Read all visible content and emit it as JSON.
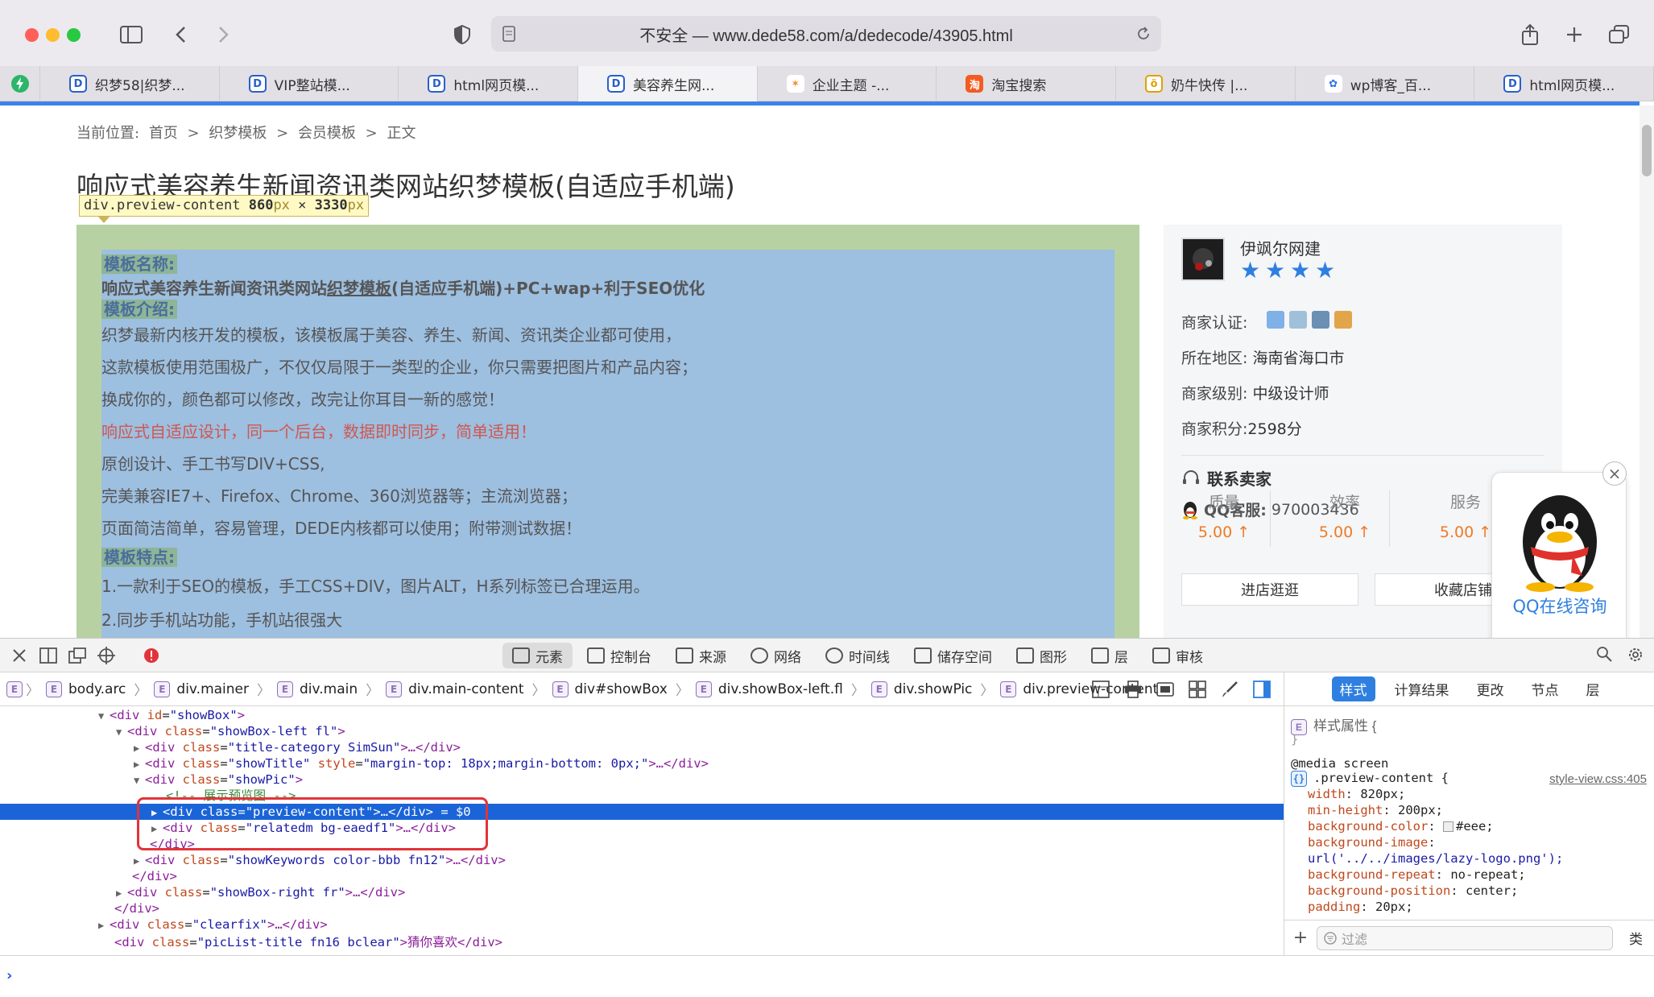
{
  "browser": {
    "url": "不安全 — www.dede58.com/a/dedecode/43905.html",
    "tabs": [
      {
        "label": "织梦58|织梦...",
        "icon": "dede-icon"
      },
      {
        "label": "VIP整站模...",
        "icon": "dede-icon"
      },
      {
        "label": "html网页模...",
        "icon": "dede-icon"
      },
      {
        "label": "美容养生网...",
        "icon": "dede-icon",
        "active": true
      },
      {
        "label": "企业主题 -...",
        "icon": "star-logo-icon"
      },
      {
        "label": "淘宝搜索",
        "icon": "taobao-icon"
      },
      {
        "label": "奶牛快传 |...",
        "icon": "cow-icon"
      },
      {
        "label": "wp博客_百...",
        "icon": "baidu-paw-icon"
      },
      {
        "label": "html网页模...",
        "icon": "dede-icon"
      }
    ],
    "tab_fav_letters": {
      "dede": "D",
      "taobao": "淘",
      "cow": "ö",
      "paw": "✿",
      "star": "✶"
    }
  },
  "page": {
    "breadcrumb": {
      "prefix": "当前位置:",
      "items": [
        "首页",
        ">",
        "织梦模板",
        ">",
        "会员模板",
        ">",
        "正文"
      ]
    },
    "title": "响应式美容养生新闻资讯类网站织梦模板(自适应手机端)",
    "tooltip": {
      "selector": "div.preview-content",
      "w": "860",
      "h": "3330",
      "px": "px",
      "x": " × "
    },
    "content": {
      "name_label": "模板名称:",
      "name_value_pre": "响应式美容养生新闻资讯类网站",
      "name_value_link": "织梦模板",
      "name_value_post": "(自适应手机端)+PC+wap+利于SEO优化",
      "intro_label": "模板介绍:",
      "intro_lines": [
        "织梦最新内核开发的模板，该模板属于美容、养生、新闻、资讯类企业都可使用，",
        "这款模板使用范围极广，不仅仅局限于一类型的企业，你只需要把图片和产品内容；",
        "换成你的，颜色都可以修改，改完让你耳目一新的感觉！"
      ],
      "red_line": "响应式自适应设计，同一个后台，数据即时同步，简单适用！",
      "lines2": [
        "原创设计、手工书写DIV+CSS,",
        "完美兼容IE7+、Firefox、Chrome、360浏览器等；主流浏览器；",
        "页面简洁简单，容易管理，DEDE内核都可以使用；附带测试数据！"
      ],
      "feature_label": "模板特点:",
      "feature_lines": [
        "1.一款利于SEO的模板，手工CSS+DIV，图片ALT，H系列标签已合理运用。",
        "2.同步手机站功能，手机站很强大"
      ]
    },
    "shop": {
      "name": "伊飒尔网建",
      "star_glyph": "★",
      "cert_label": "商家认证:",
      "region_label": "所在地区:",
      "region": "海南省海口市",
      "level_label": "商家级别:",
      "level": "中级设计师",
      "points_label": "商家积分:",
      "points": "2598分",
      "contact_title": "联系卖家",
      "qq_label": "QQ客服:",
      "qq": "970003436",
      "scores": [
        {
          "label": "质量",
          "value": "5.00 ↑"
        },
        {
          "label": "效率",
          "value": "5.00 ↑"
        },
        {
          "label": "服务",
          "value": "5.00 ↑"
        }
      ],
      "btn_visit": "进店逛逛",
      "btn_fav": "收藏店铺"
    },
    "qq_float": {
      "label": "QQ在线咨询",
      "close": "×"
    }
  },
  "devtools": {
    "tabs": [
      "元素",
      "控制台",
      "来源",
      "网络",
      "时间线",
      "储存空间",
      "图形",
      "层",
      "审核"
    ],
    "crumbs": [
      "body.arc",
      "div.mainer",
      "div.main",
      "div.main-content",
      "div#showBox",
      "div.showBox-left.fl",
      "div.showPic",
      "div.preview-content"
    ],
    "crumb_badge": "E",
    "dom": {
      "l1": {
        "tag": "div",
        "attr": "id",
        "val": "\"showBox\"",
        "close": ">"
      },
      "l2": {
        "tag": "div",
        "attr": "class",
        "val": "\"showBox-left fl\"",
        "close": ">"
      },
      "l3": {
        "attr": "class",
        "val": "\"title-category SimSun\"",
        "rest": ">…</div>"
      },
      "l4": {
        "attr1": "class",
        "val1": "\"showTitle\"",
        "attr2": "style",
        "val2": "\"margin-top: 18px;margin-bottom: 0px;\"",
        "rest": ">…</div>"
      },
      "l5": {
        "attr": "class",
        "val": "\"showPic\"",
        "close": ">"
      },
      "l6": {
        "comment": "<!-- 展示预览图 -->"
      },
      "l7": {
        "attr": "class",
        "val": "\"preview-content\"",
        "rest": ">…</div>",
        "eq": " = $0"
      },
      "l8": {
        "attr": "class",
        "val": "\"relatedm bg-eaedf1\"",
        "rest": ">…</div>"
      },
      "l9": {
        "text": "</div>"
      },
      "l10": {
        "attr": "class",
        "val": "\"showKeywords color-bbb fn12\"",
        "rest": ">…</div>"
      },
      "l11": {
        "text": "</div>"
      },
      "l12": {
        "attr": "class",
        "val": "\"showBox-right fr\"",
        "rest": ">…</div>"
      },
      "l13": {
        "text": "</div>"
      },
      "l14": {
        "attr": "class",
        "val": "\"clearfix\"",
        "rest": ">…</div>"
      },
      "l15": {
        "attr": "class",
        "val": "\"picList-title fn16 bclear\"",
        "rest": ">猜你喜欢</div>"
      },
      "open_tag": "<div ",
      "eq_sign": "="
    },
    "sidebar": {
      "tabs": [
        "样式",
        "计算结果",
        "更改",
        "节点",
        "层"
      ],
      "style_attr": "样式属性 {",
      "style_attr_close": "}",
      "media": "@media screen",
      "selector": ".preview-content {",
      "source": "style-view.css:405",
      "props": [
        {
          "name": "width",
          "value": "820px;"
        },
        {
          "name": "min-height",
          "value": "200px;"
        },
        {
          "name": "background-color",
          "value": "#eee;"
        },
        {
          "name": "background-image",
          "value": ""
        },
        {
          "name": "url",
          "value": "url('../../images/lazy-logo.png');"
        },
        {
          "name": "background-repeat",
          "value": "no-repeat;"
        },
        {
          "name": "background-position",
          "value": "center;"
        },
        {
          "name": "padding",
          "value": "20px;"
        }
      ],
      "filter_placeholder": "过滤",
      "class_btn": "类"
    }
  }
}
